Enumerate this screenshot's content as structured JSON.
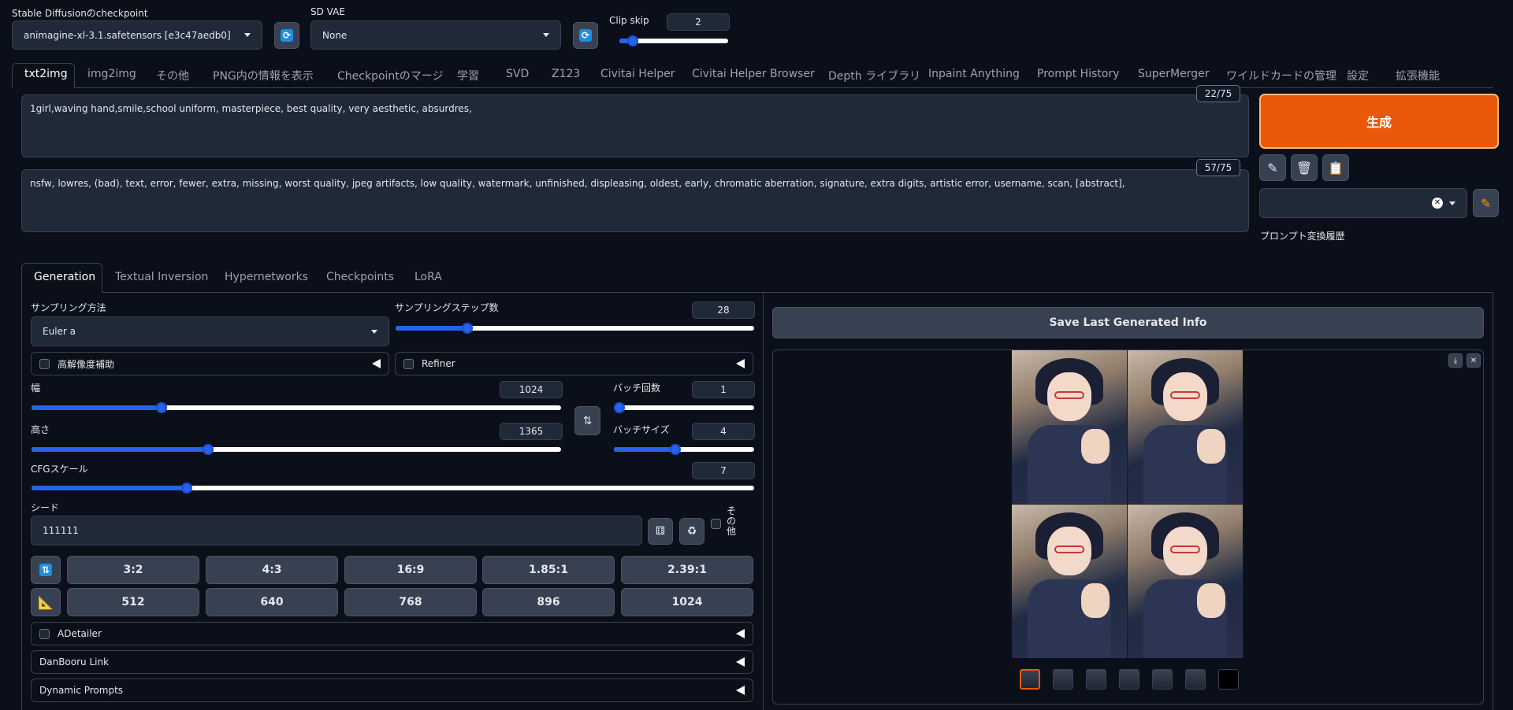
{
  "header": {
    "checkpoint_label": "Stable Diffusionのcheckpoint",
    "checkpoint_value": "animagine-xl-3.1.safetensors [e3c47aedb0]",
    "vae_label": "SD VAE",
    "vae_value": "None",
    "clip_skip_label": "Clip skip",
    "clip_skip_value": "2",
    "clip_skip_fraction": 0.08
  },
  "tabs": [
    "txt2img",
    "img2img",
    "その他",
    "PNG内の情報を表示",
    "Checkpointのマージ",
    "学習",
    "SVD",
    "Z123",
    "Civitai Helper",
    "Civitai Helper Browser",
    "Depth ライブラリ",
    "Inpaint Anything",
    "Prompt History",
    "SuperMerger",
    "ワイルドカードの管理",
    "設定",
    "拡張機能"
  ],
  "prompt": {
    "positive": "1girl,waving hand,smile,school uniform, masterpiece, best quality, very aesthetic, absurdres,",
    "positive_count": "22/75",
    "negative": "nsfw, lowres, (bad), text, error, fewer, extra, missing, worst quality, jpeg artifacts, low quality, watermark, unfinished, displeasing, oldest, early, chromatic aberration, signature, extra digits, artistic error, username, scan, [abstract],",
    "negative_count": "57/75"
  },
  "actions": {
    "generate_label": "生成",
    "style_history_label": "プロンプト変換履歴",
    "accent": "#ea580c"
  },
  "subtabs": [
    "Generation",
    "Textual Inversion",
    "Hypernetworks",
    "Checkpoints",
    "LoRA"
  ],
  "generation": {
    "sampler_label": "サンプリング方法",
    "sampler_value": "Euler a",
    "steps_label": "サンプリングステップ数",
    "steps_value": "28",
    "steps_fraction": 0.19,
    "hires_label": "高解像度補助",
    "refiner_label": "Refiner",
    "width_label": "幅",
    "width_value": "1024",
    "width_fraction": 0.24,
    "height_label": "高さ",
    "height_value": "1365",
    "height_fraction": 0.33,
    "batch_count_label": "バッチ回数",
    "batch_count_value": "1",
    "batch_count_fraction": 0.0,
    "batch_size_label": "バッチサイズ",
    "batch_size_value": "4",
    "batch_size_fraction": 0.43,
    "cfg_label": "CFGスケール",
    "cfg_value": "7",
    "cfg_fraction": 0.21,
    "seed_label": "シード",
    "seed_value": "111111",
    "extra_label": "その他",
    "ratios": [
      "3:2",
      "4:3",
      "16:9",
      "1.85:1",
      "2.39:1"
    ],
    "sizes": [
      "512",
      "640",
      "768",
      "896",
      "1024"
    ],
    "extensions": [
      "ADetailer",
      "DanBooru Link",
      "Dynamic Prompts"
    ]
  },
  "output": {
    "save_info_label": "Save Last Generated Info",
    "thumbnail_count": 7
  }
}
